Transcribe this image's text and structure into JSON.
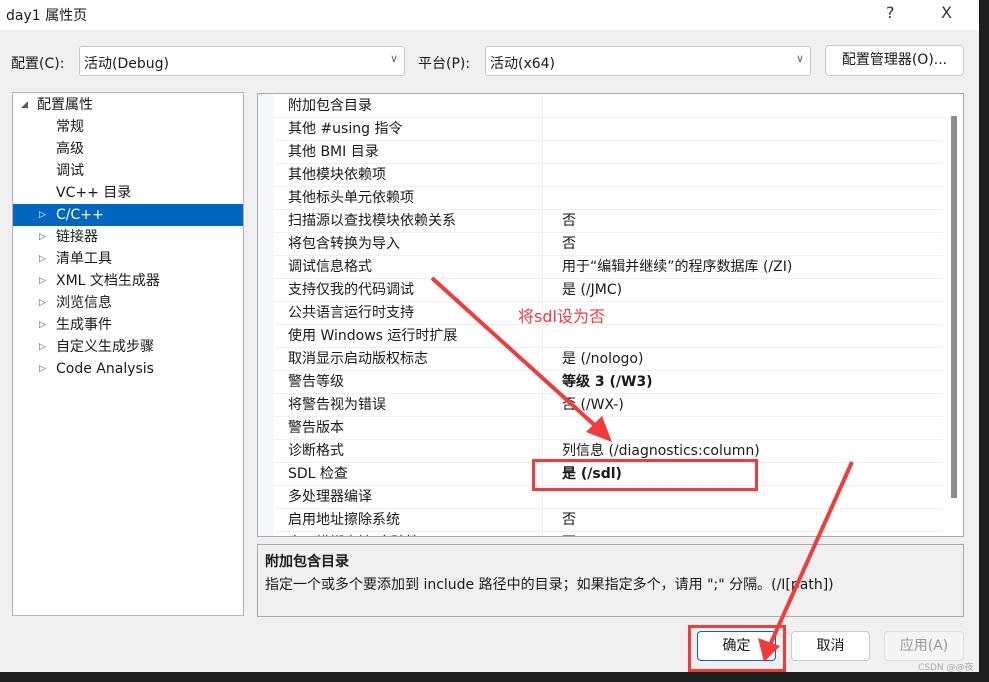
{
  "window": {
    "title": "day1 属性页",
    "help": "?",
    "close": "X"
  },
  "toolbar": {
    "config_label": "配置(C):",
    "config_value": "活动(Debug)",
    "platform_label": "平台(P):",
    "platform_value": "活动(x64)",
    "manager_button": "配置管理器(O)..."
  },
  "tree": {
    "root": "配置属性",
    "items": [
      {
        "label": "常规",
        "expandable": false
      },
      {
        "label": "高级",
        "expandable": false
      },
      {
        "label": "调试",
        "expandable": false
      },
      {
        "label": "VC++ 目录",
        "expandable": false
      },
      {
        "label": "C/C++",
        "expandable": true,
        "selected": true
      },
      {
        "label": "链接器",
        "expandable": true
      },
      {
        "label": "清单工具",
        "expandable": true
      },
      {
        "label": "XML 文档生成器",
        "expandable": true
      },
      {
        "label": "浏览信息",
        "expandable": true
      },
      {
        "label": "生成事件",
        "expandable": true
      },
      {
        "label": "自定义生成步骤",
        "expandable": true
      },
      {
        "label": "Code Analysis",
        "expandable": true
      }
    ]
  },
  "grid": {
    "rows": [
      {
        "k": "附加包含目录",
        "v": ""
      },
      {
        "k": "其他 #using 指令",
        "v": ""
      },
      {
        "k": "其他 BMI 目录",
        "v": ""
      },
      {
        "k": "其他模块依赖项",
        "v": ""
      },
      {
        "k": "其他标头单元依赖项",
        "v": ""
      },
      {
        "k": "扫描源以查找模块依赖关系",
        "v": "否"
      },
      {
        "k": "将包含转换为导入",
        "v": "否"
      },
      {
        "k": "调试信息格式",
        "v": "用于“编辑并继续”的程序数据库 (/ZI)"
      },
      {
        "k": "支持仅我的代码调试",
        "v": "是 (/JMC)"
      },
      {
        "k": "公共语言运行时支持",
        "v": ""
      },
      {
        "k": "使用 Windows 运行时扩展",
        "v": ""
      },
      {
        "k": "取消显示启动版权标志",
        "v": "是 (/nologo)"
      },
      {
        "k": "警告等级",
        "v": "等级 3 (/W3)",
        "bold": true
      },
      {
        "k": "将警告视为错误",
        "v": "否 (/WX-)"
      },
      {
        "k": "警告版本",
        "v": ""
      },
      {
        "k": "诊断格式",
        "v": "列信息 (/diagnostics:column)"
      },
      {
        "k": "SDL 检查",
        "v": "是 (/sdl)",
        "bold": true
      },
      {
        "k": "多处理器编译",
        "v": ""
      },
      {
        "k": "启用地址擦除系统",
        "v": "否"
      },
      {
        "k": "启用模糊支持(实验性)",
        "v": "否"
      }
    ]
  },
  "description": {
    "title": "附加包含目录",
    "text": "指定一个或多个要添加到 include 路径中的目录；如果指定多个，请用 \";\" 分隔。(/I[path])"
  },
  "buttons": {
    "ok": "确定",
    "cancel": "取消",
    "apply": "应用(A)"
  },
  "annotation": {
    "note": "将sdl设为否",
    "color": "#f23b3b"
  },
  "watermark": "CSDN @@夜"
}
